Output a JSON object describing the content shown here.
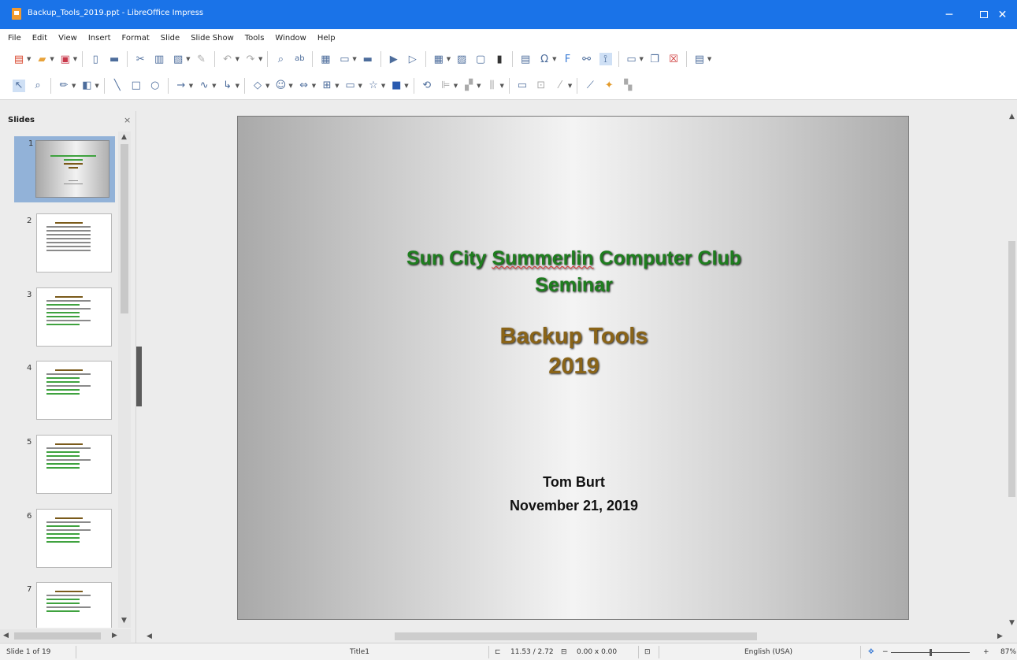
{
  "window": {
    "title": "Backup_Tools_2019.ppt - LibreOffice Impress",
    "minimize": "─",
    "close": "✕"
  },
  "menu": [
    "File",
    "Edit",
    "View",
    "Insert",
    "Format",
    "Slide",
    "Slide Show",
    "Tools",
    "Window",
    "Help"
  ],
  "toolbar1_icons": [
    "new-doc",
    "open-folder",
    "save",
    "export-pdf",
    "print",
    "cut",
    "copy",
    "paste",
    "clone-format",
    "undo",
    "redo",
    "find-replace",
    "spelling",
    "display-grid",
    "display-views",
    "master-slide",
    "start-first-slide",
    "start-current-slide",
    "insert-table",
    "insert-image",
    "insert-media",
    "insert-chart",
    "insert-textbox",
    "special-character",
    "fontwork",
    "insert-hyperlink",
    "show-draw-functions",
    "new-slide",
    "duplicate-slide",
    "delete-slide",
    "slide-layout"
  ],
  "toolbar2_icons": [
    "select",
    "zoom",
    "line-color",
    "fill-color",
    "line",
    "rectangle",
    "ellipse",
    "arrow-line",
    "curve",
    "connector",
    "basic-shapes",
    "symbol-shapes",
    "block-arrows",
    "flowchart",
    "callouts",
    "stars",
    "3d-objects",
    "rotate",
    "align",
    "arrange",
    "distribute",
    "shadow",
    "crop",
    "filter",
    "points",
    "glue-points",
    "extrusion"
  ],
  "slides_panel": {
    "title": "Slides",
    "close": "×",
    "thumbnails": [
      {
        "number": "1",
        "selected": true
      },
      {
        "number": "2",
        "selected": false
      },
      {
        "number": "3",
        "selected": false
      },
      {
        "number": "4",
        "selected": false
      },
      {
        "number": "5",
        "selected": false
      },
      {
        "number": "6",
        "selected": false
      },
      {
        "number": "7",
        "selected": false
      }
    ]
  },
  "slide": {
    "title_line1_part1": "Sun City ",
    "title_line1_spell": "Summerlin",
    "title_line1_part2": " Computer Club",
    "title_line2": "Seminar",
    "subtitle_line1": "Backup Tools",
    "subtitle_line2": "2019",
    "author": "Tom Burt",
    "date": "November 21, 2019"
  },
  "colors": {
    "title_bar": "#1a73e8",
    "title_text": "#1e7e1e",
    "subtitle_text": "#8a6418"
  },
  "statusbar": {
    "slide_info": "Slide 1 of 19",
    "layout": "Title1",
    "position": "11.53 / 2.72",
    "size": "0.00 x 0.00",
    "language": "English (USA)",
    "zoom_minus": "−",
    "zoom_plus": "+",
    "zoom": "87%"
  }
}
